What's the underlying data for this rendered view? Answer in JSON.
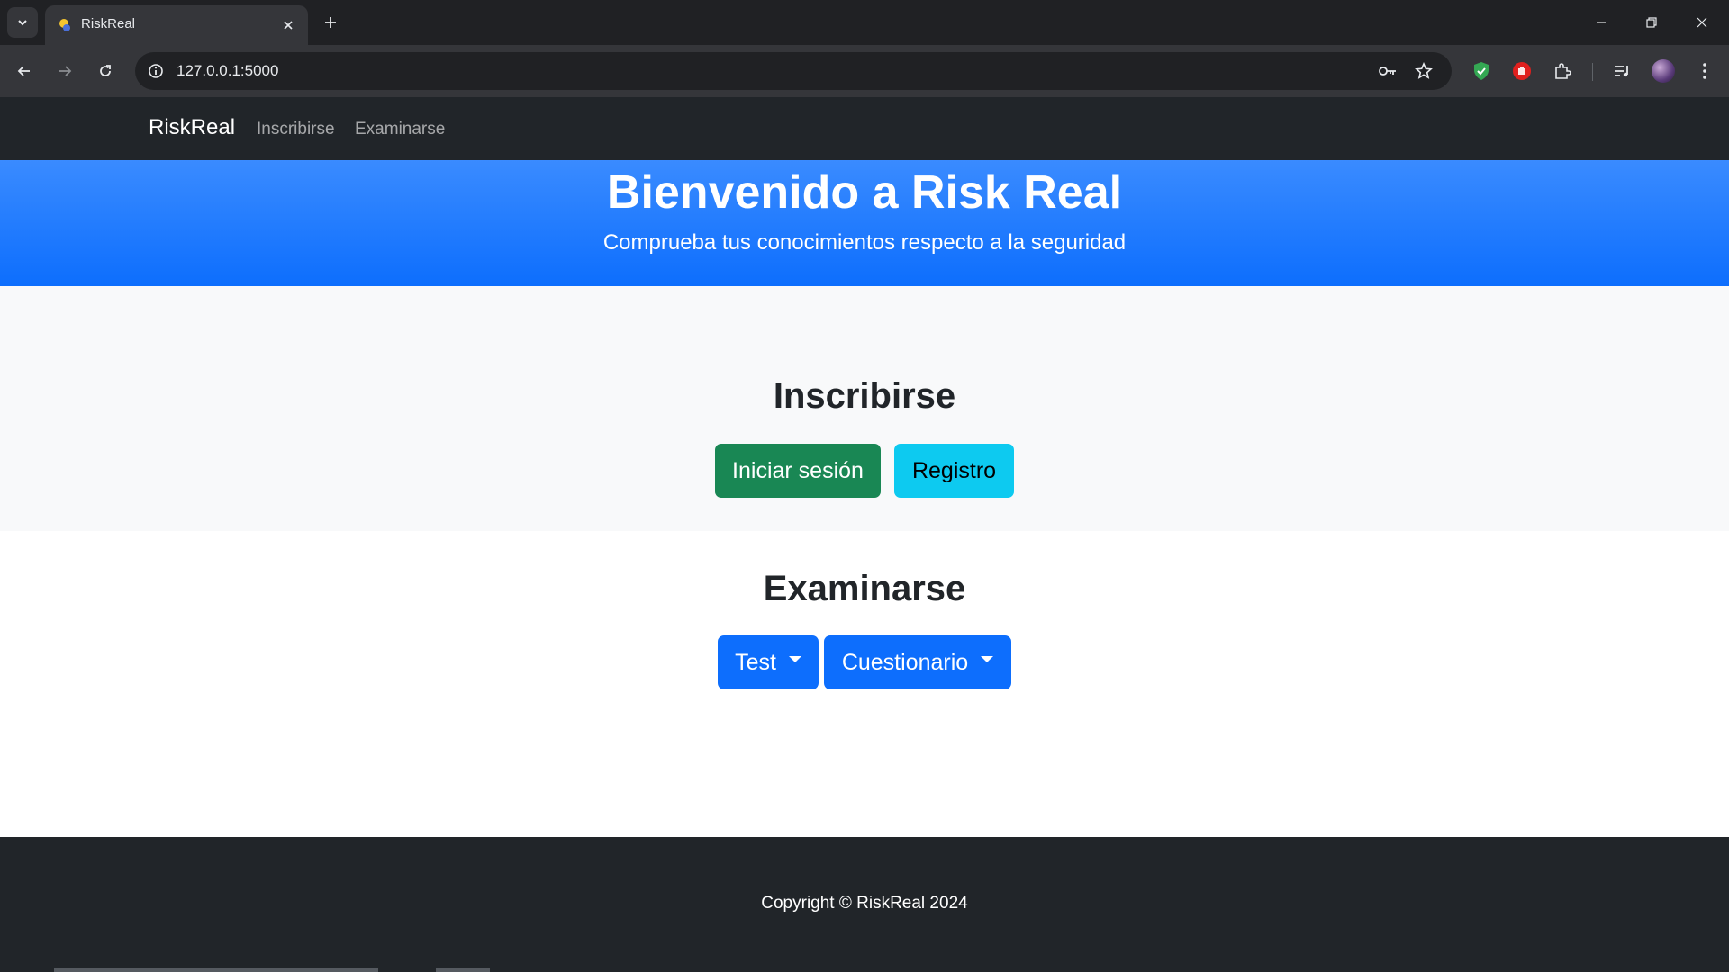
{
  "browser": {
    "tab_title": "RiskReal",
    "url": "127.0.0.1:5000",
    "icons": {
      "tab_list": "chevron-down-icon",
      "tab_close": "close-icon",
      "new_tab": "plus-icon",
      "back": "arrow-left-icon",
      "forward": "arrow-right-icon",
      "reload": "reload-icon",
      "site_info": "info-icon",
      "password": "key-icon",
      "bookmark": "star-icon",
      "extension_shield": "shield-icon",
      "extension_adblock": "stop-hand-icon",
      "extensions": "puzzle-icon",
      "media": "media-queue-icon",
      "menu": "kebab-menu-icon"
    }
  },
  "navbar": {
    "brand": "RiskReal",
    "links": [
      "Inscribirse",
      "Examinarse"
    ]
  },
  "hero": {
    "title": "Bienvenido a Risk Real",
    "subtitle": "Comprueba tus conocimientos respecto a la seguridad"
  },
  "inscribirse": {
    "title": "Inscribirse",
    "login_label": "Iniciar sesión",
    "register_label": "Registro"
  },
  "examinarse": {
    "title": "Examinarse",
    "test_label": "Test",
    "questionnaire_label": "Cuestionario"
  },
  "footer": {
    "copyright": "Copyright © RiskReal 2024"
  },
  "colors": {
    "navbar_bg": "#212529",
    "hero_bg": "#0d6efd",
    "success": "#198754",
    "info": "#0dcaf0",
    "primary": "#0d6efd",
    "light_section": "#f8f9fa"
  }
}
